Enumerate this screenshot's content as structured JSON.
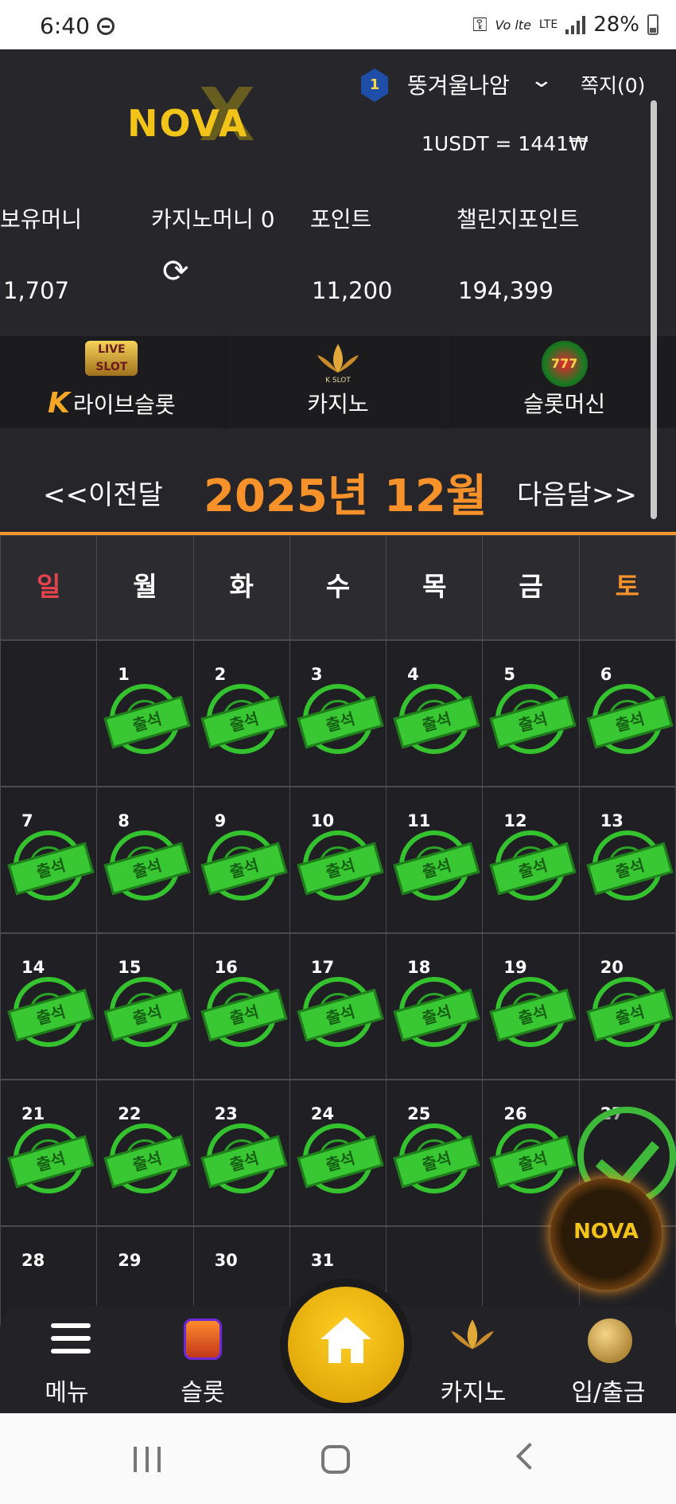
{
  "status_bar": {
    "time": "6:40",
    "battery": "28%",
    "lte": "LTE",
    "volte": "Vo lte"
  },
  "header": {
    "logo_text": "NOVA",
    "logo_x": "X",
    "rank_level": "1",
    "username": "뚱겨울나암",
    "messages_label": "쪽지(0)",
    "exchange_rate": "1USDT = 1441₩"
  },
  "balances": {
    "held_money_label": "보유머니",
    "held_money_value": "1,707",
    "casino_money_label": "카지노머니 0",
    "point_label": "포인트",
    "point_value": "11,200",
    "challenge_point_label": "챌린지포인트",
    "challenge_point_value": "194,399"
  },
  "game_tabs": [
    {
      "label": "라이브슬롯",
      "prefix": "K",
      "icon_text": "LIVE SLOT"
    },
    {
      "label": "카지노",
      "icon_text": "K SLOT"
    },
    {
      "label": "슬롯머신",
      "icon_text": "777"
    }
  ],
  "calendar": {
    "prev_label": "<<이전달",
    "month_label": "2025년 12월",
    "next_label": "다음달>>",
    "weekdays": [
      "일",
      "월",
      "화",
      "수",
      "목",
      "금",
      "토"
    ],
    "weekday_colors": {
      "sun": "#e8434d",
      "sat": "#f7922b",
      "normal": "#ffffff"
    },
    "stamp_text": "출석",
    "weeks": [
      [
        null,
        1,
        2,
        3,
        4,
        5,
        6
      ],
      [
        7,
        8,
        9,
        10,
        11,
        12,
        13
      ],
      [
        14,
        15,
        16,
        17,
        18,
        19,
        20
      ],
      [
        21,
        22,
        23,
        24,
        25,
        26,
        27
      ],
      [
        28,
        29,
        30,
        31,
        null,
        null,
        null
      ]
    ],
    "attended_through": 26
  },
  "fab": {
    "nova_label": "NOVA"
  },
  "bottom_nav": [
    {
      "label": "메뉴"
    },
    {
      "label": "슬롯"
    },
    {
      "label": "카지노"
    },
    {
      "label": "입/출금"
    }
  ],
  "colors": {
    "accent": "#f7922b",
    "stamp_green": "#39c833",
    "home_yellow": "#ffc61a"
  }
}
